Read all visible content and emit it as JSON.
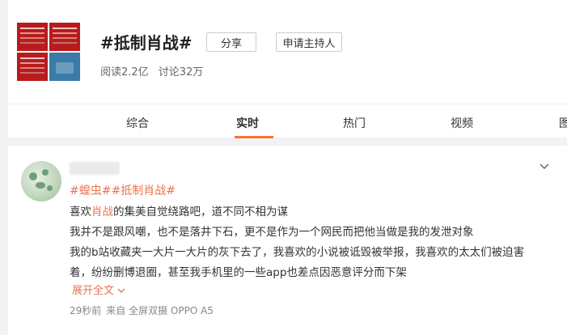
{
  "topic": {
    "title": "#抵制肖战#",
    "share_label": "分享",
    "host_label": "申请主持人",
    "reads": "阅读2.2亿",
    "discussions": "讨论32万"
  },
  "tabs": [
    {
      "label": "综合"
    },
    {
      "label": "实时"
    },
    {
      "label": "热门"
    },
    {
      "label": "视频"
    },
    {
      "label": "图"
    }
  ],
  "post": {
    "tags": [
      "#蝗虫#",
      "#抵制肖战#"
    ],
    "line1_before": "喜欢",
    "line1_highlight": "肖战",
    "line1_after": "的集美自觉绕路吧，道不同不相为谋",
    "line2": "我并不是跟风嘲，也不是落井下石，更不是作为一个网民而把他当做是我的发泄对象",
    "line3": "我的b站收藏夹一大片一大片的灰下去了，我喜欢的小说被诋毁被举报，我喜欢的太太们被迫害",
    "line4": "着，纷纷删博退圈，甚至我手机里的一些app也差点因恶意评分而下架",
    "expand_label": "展开全文",
    "time": "29秒前",
    "source": "来自 全屏双摄 OPPO A5"
  },
  "icons": {
    "menu": "chevron-down-icon",
    "expand": "chevron-down-icon"
  },
  "colors": {
    "accent": "#eb7350",
    "tab_underline": "#f77234"
  }
}
